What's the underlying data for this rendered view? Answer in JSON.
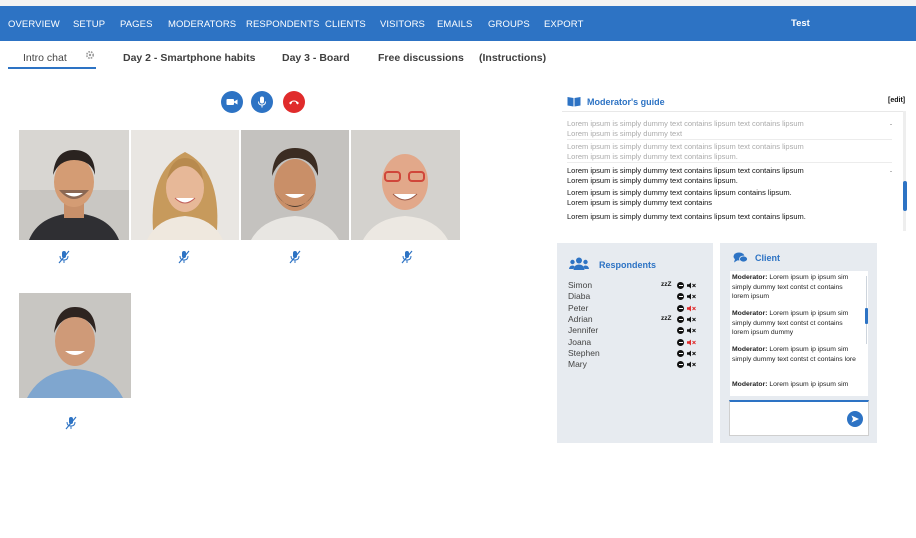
{
  "nav": {
    "items": [
      "OVERVIEW",
      "SETUP",
      "PAGES",
      "MODERATORS",
      "RESPONDENTS",
      "CLIENTS",
      "VISITORS",
      "EMAILS",
      "GROUPS",
      "EXPORT"
    ],
    "user": "Test"
  },
  "tabs": [
    "Intro chat",
    "Day 2 - Smartphone habits",
    "Day 3 - Board",
    "Free discussions",
    "(Instructions)"
  ],
  "controls": {
    "camera_color": "#2d73c4",
    "mic_color": "#2d73c4",
    "hangup_color": "#e02b2b"
  },
  "guide": {
    "title": "Moderator's guide",
    "edit": "[edit]",
    "entries": [
      {
        "line1": "Lorem ipsum is simply dummy text contains lipsum text contains lipsum",
        "line2": "Lorem ipsum is simply dummy text",
        "faded": true
      },
      {
        "line1": "Lorem ipsum is simply dummy text contains lipsum text contains lipsum",
        "line2": "Lorem ipsum is simply dummy text contains lipsum.",
        "faded": true
      },
      {
        "line1": "Lorem ipsum is simply dummy text contains lipsum text contains lipsum",
        "line2": "Lorem ipsum is simply dummy text contains lipsum.",
        "faded": false
      },
      {
        "line1": "Lorem ipsum is simply dummy text contains lipsum contains lipsum.",
        "line2": "Lorem ipsum is simply dummy text contains",
        "faded": false
      },
      {
        "line1": "Lorem ipsum is simply dummy text contains lipsum text contains lipsum.",
        "line2": "",
        "faded": false
      }
    ]
  },
  "respondents": {
    "title": "Respondents",
    "list": [
      {
        "name": "Simon",
        "zzz": "zzZ",
        "speaker_color": "#111111"
      },
      {
        "name": "Diaba",
        "zzz": "",
        "speaker_color": "#111111"
      },
      {
        "name": "Peter",
        "zzz": "",
        "speaker_color": "#e02b2b"
      },
      {
        "name": "Adrian",
        "zzz": "zzZ",
        "speaker_color": "#111111"
      },
      {
        "name": "Jennifer",
        "zzz": "",
        "speaker_color": "#111111"
      },
      {
        "name": "Joana",
        "zzz": "",
        "speaker_color": "#e02b2b"
      },
      {
        "name": "Stephen",
        "zzz": "",
        "speaker_color": "#111111"
      },
      {
        "name": "Mary",
        "zzz": "",
        "speaker_color": "#111111"
      }
    ]
  },
  "client": {
    "title": "Client",
    "messages": [
      {
        "author": "Moderator:",
        "text": "Lorem ipsum ip ipsum sim simply dummy text contst ct contains lorem ipsum"
      },
      {
        "author": "Moderator:",
        "text": "Lorem ipsum ip ipsum sim simply dummy text contst ct contains lorem ipsum dummy"
      },
      {
        "author": "Moderator:",
        "text": "Lorem ipsum ip ipsum sim simply dummy text contst ct contains lore"
      },
      {
        "author": "Moderator:",
        "text": "Lorem ipsum ip ipsum sim"
      }
    ],
    "input_value": ""
  }
}
